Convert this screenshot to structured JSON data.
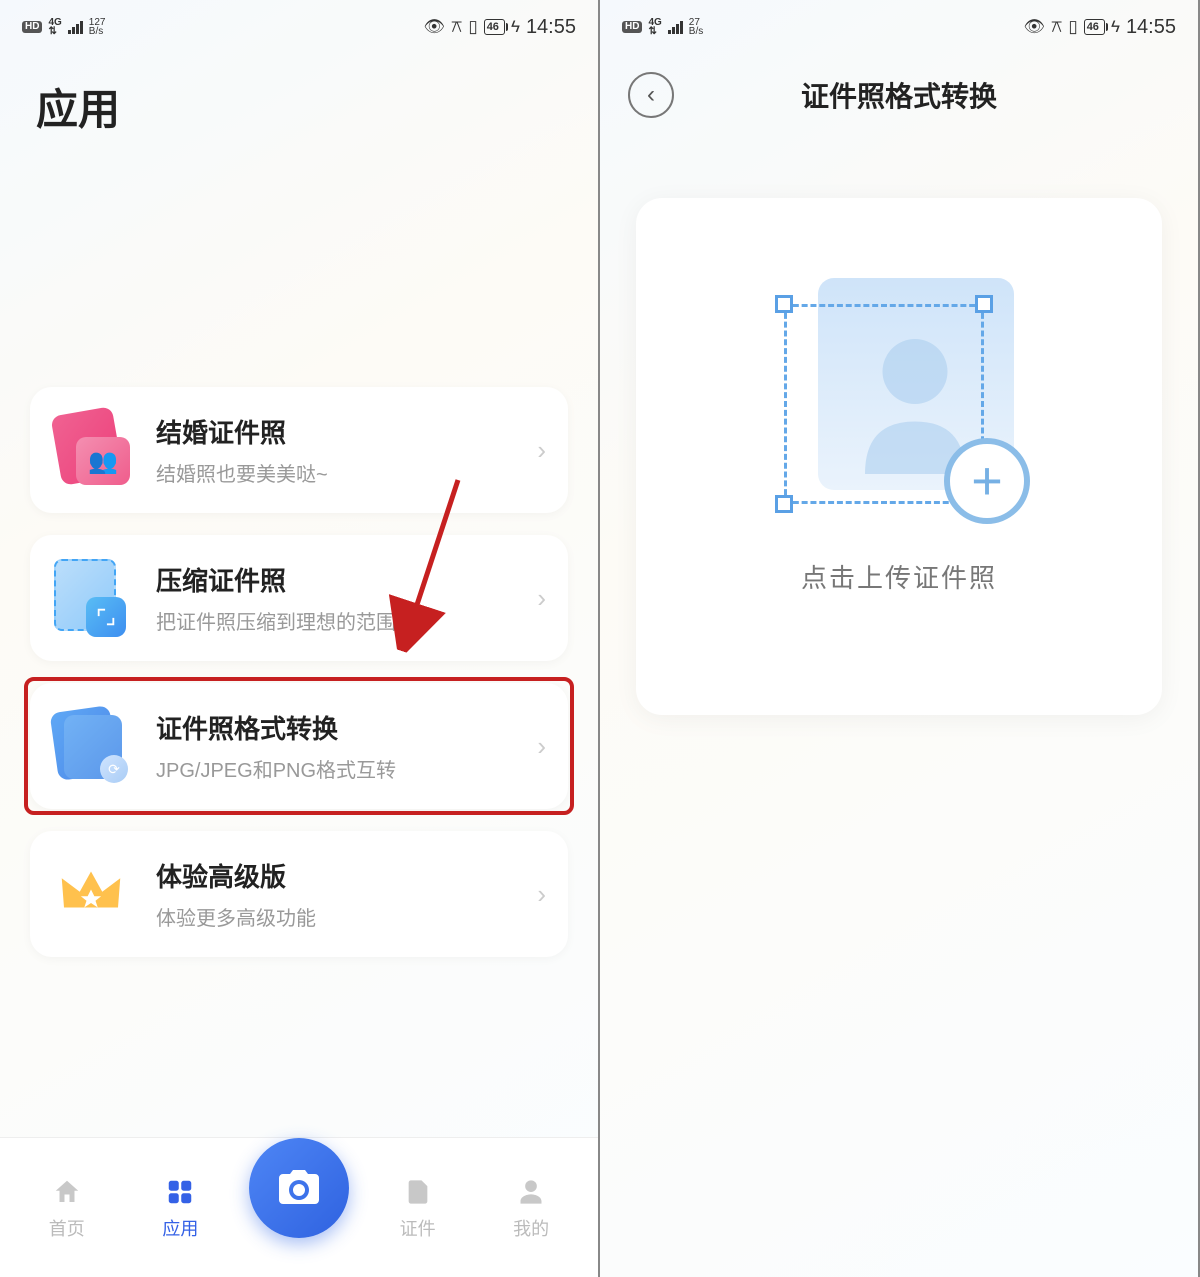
{
  "left": {
    "status": {
      "hd": "HD",
      "net": "4G",
      "speed_top": "127",
      "speed_unit": "B/s",
      "battery": "46",
      "time": "14:55"
    },
    "page_title": "应用",
    "cards": [
      {
        "title": "结婚证件照",
        "subtitle": "结婚照也要美美哒~"
      },
      {
        "title": "压缩证件照",
        "subtitle": "把证件照压缩到理想的范围内"
      },
      {
        "title": "证件照格式转换",
        "subtitle": "JPG/JPEG和PNG格式互转"
      },
      {
        "title": "体验高级版",
        "subtitle": "体验更多高级功能"
      }
    ],
    "nav": {
      "home": "首页",
      "apps": "应用",
      "docs": "证件",
      "mine": "我的"
    }
  },
  "right": {
    "status": {
      "hd": "HD",
      "net": "4G",
      "speed_top": "27",
      "speed_unit": "B/s",
      "battery": "46",
      "time": "14:55"
    },
    "title": "证件照格式转换",
    "upload_text": "点击上传证件照"
  }
}
